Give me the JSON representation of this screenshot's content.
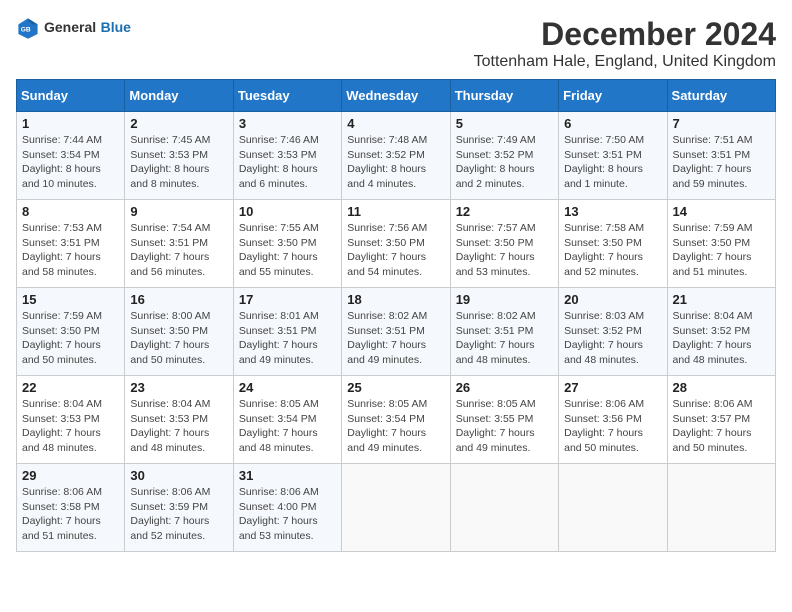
{
  "header": {
    "logo_general": "General",
    "logo_blue": "Blue",
    "month_year": "December 2024",
    "location": "Tottenham Hale, England, United Kingdom"
  },
  "columns": [
    "Sunday",
    "Monday",
    "Tuesday",
    "Wednesday",
    "Thursday",
    "Friday",
    "Saturday"
  ],
  "weeks": [
    [
      {
        "day": "1",
        "sunrise": "7:44 AM",
        "sunset": "3:54 PM",
        "daylight": "8 hours and 10 minutes."
      },
      {
        "day": "2",
        "sunrise": "7:45 AM",
        "sunset": "3:53 PM",
        "daylight": "8 hours and 8 minutes."
      },
      {
        "day": "3",
        "sunrise": "7:46 AM",
        "sunset": "3:53 PM",
        "daylight": "8 hours and 6 minutes."
      },
      {
        "day": "4",
        "sunrise": "7:48 AM",
        "sunset": "3:52 PM",
        "daylight": "8 hours and 4 minutes."
      },
      {
        "day": "5",
        "sunrise": "7:49 AM",
        "sunset": "3:52 PM",
        "daylight": "8 hours and 2 minutes."
      },
      {
        "day": "6",
        "sunrise": "7:50 AM",
        "sunset": "3:51 PM",
        "daylight": "8 hours and 1 minute."
      },
      {
        "day": "7",
        "sunrise": "7:51 AM",
        "sunset": "3:51 PM",
        "daylight": "7 hours and 59 minutes."
      }
    ],
    [
      {
        "day": "8",
        "sunrise": "7:53 AM",
        "sunset": "3:51 PM",
        "daylight": "7 hours and 58 minutes."
      },
      {
        "day": "9",
        "sunrise": "7:54 AM",
        "sunset": "3:51 PM",
        "daylight": "7 hours and 56 minutes."
      },
      {
        "day": "10",
        "sunrise": "7:55 AM",
        "sunset": "3:50 PM",
        "daylight": "7 hours and 55 minutes."
      },
      {
        "day": "11",
        "sunrise": "7:56 AM",
        "sunset": "3:50 PM",
        "daylight": "7 hours and 54 minutes."
      },
      {
        "day": "12",
        "sunrise": "7:57 AM",
        "sunset": "3:50 PM",
        "daylight": "7 hours and 53 minutes."
      },
      {
        "day": "13",
        "sunrise": "7:58 AM",
        "sunset": "3:50 PM",
        "daylight": "7 hours and 52 minutes."
      },
      {
        "day": "14",
        "sunrise": "7:59 AM",
        "sunset": "3:50 PM",
        "daylight": "7 hours and 51 minutes."
      }
    ],
    [
      {
        "day": "15",
        "sunrise": "7:59 AM",
        "sunset": "3:50 PM",
        "daylight": "7 hours and 50 minutes."
      },
      {
        "day": "16",
        "sunrise": "8:00 AM",
        "sunset": "3:50 PM",
        "daylight": "7 hours and 50 minutes."
      },
      {
        "day": "17",
        "sunrise": "8:01 AM",
        "sunset": "3:51 PM",
        "daylight": "7 hours and 49 minutes."
      },
      {
        "day": "18",
        "sunrise": "8:02 AM",
        "sunset": "3:51 PM",
        "daylight": "7 hours and 49 minutes."
      },
      {
        "day": "19",
        "sunrise": "8:02 AM",
        "sunset": "3:51 PM",
        "daylight": "7 hours and 48 minutes."
      },
      {
        "day": "20",
        "sunrise": "8:03 AM",
        "sunset": "3:52 PM",
        "daylight": "7 hours and 48 minutes."
      },
      {
        "day": "21",
        "sunrise": "8:04 AM",
        "sunset": "3:52 PM",
        "daylight": "7 hours and 48 minutes."
      }
    ],
    [
      {
        "day": "22",
        "sunrise": "8:04 AM",
        "sunset": "3:53 PM",
        "daylight": "7 hours and 48 minutes."
      },
      {
        "day": "23",
        "sunrise": "8:04 AM",
        "sunset": "3:53 PM",
        "daylight": "7 hours and 48 minutes."
      },
      {
        "day": "24",
        "sunrise": "8:05 AM",
        "sunset": "3:54 PM",
        "daylight": "7 hours and 48 minutes."
      },
      {
        "day": "25",
        "sunrise": "8:05 AM",
        "sunset": "3:54 PM",
        "daylight": "7 hours and 49 minutes."
      },
      {
        "day": "26",
        "sunrise": "8:05 AM",
        "sunset": "3:55 PM",
        "daylight": "7 hours and 49 minutes."
      },
      {
        "day": "27",
        "sunrise": "8:06 AM",
        "sunset": "3:56 PM",
        "daylight": "7 hours and 50 minutes."
      },
      {
        "day": "28",
        "sunrise": "8:06 AM",
        "sunset": "3:57 PM",
        "daylight": "7 hours and 50 minutes."
      }
    ],
    [
      {
        "day": "29",
        "sunrise": "8:06 AM",
        "sunset": "3:58 PM",
        "daylight": "7 hours and 51 minutes."
      },
      {
        "day": "30",
        "sunrise": "8:06 AM",
        "sunset": "3:59 PM",
        "daylight": "7 hours and 52 minutes."
      },
      {
        "day": "31",
        "sunrise": "8:06 AM",
        "sunset": "4:00 PM",
        "daylight": "7 hours and 53 minutes."
      },
      null,
      null,
      null,
      null
    ]
  ]
}
